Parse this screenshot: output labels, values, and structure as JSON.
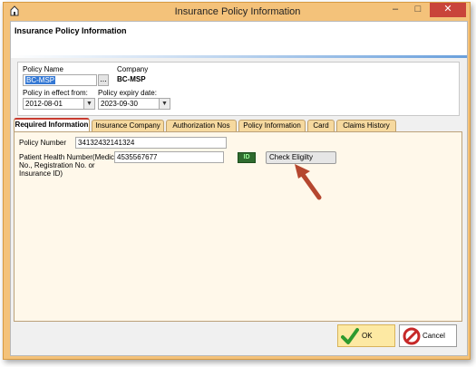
{
  "window": {
    "title": "Insurance Policy Information",
    "controls": {
      "minimize": "–",
      "maximize": "□",
      "close": "✕"
    }
  },
  "header": {
    "title": "Insurance Policy Information"
  },
  "policy": {
    "name_label": "Policy Name",
    "name_value": "BC-MSP",
    "browse_label": "...",
    "company_label": "Company",
    "company_value": "BC-MSP",
    "effective_label": "Policy in effect from:",
    "effective_value": "2012-08-01",
    "expiry_label": "Policy expiry date:",
    "expiry_value": "2023-09-30"
  },
  "tabs": [
    {
      "label": "Required Information",
      "active": true
    },
    {
      "label": "Insurance Company"
    },
    {
      "label": "Authorization Nos"
    },
    {
      "label": "Policy Information"
    },
    {
      "label": "Card"
    },
    {
      "label": "Claims History"
    }
  ],
  "required": {
    "policy_number_label": "Policy Number",
    "policy_number_value": "34132432141324",
    "phn_label_line1": "Patient Health Number(Medicare",
    "phn_label_line2": "No., Registration No. or",
    "phn_label_line3": "Insurance ID)",
    "phn_value": "4535567677",
    "id_icon_text": "ID",
    "check_eligibility_label": "Check Eligilty"
  },
  "buttons": {
    "ok": "OK",
    "cancel": "Cancel"
  },
  "colors": {
    "accent_arrow": "#b5472f",
    "window_frame": "#f4c27a",
    "tab_active_border": "#c83b2f"
  },
  "icons": [
    "app-icon",
    "ellipsis-icon",
    "dropdown-icon",
    "id-icon",
    "check-icon",
    "cancel-icon",
    "annotation-arrow-icon"
  ]
}
